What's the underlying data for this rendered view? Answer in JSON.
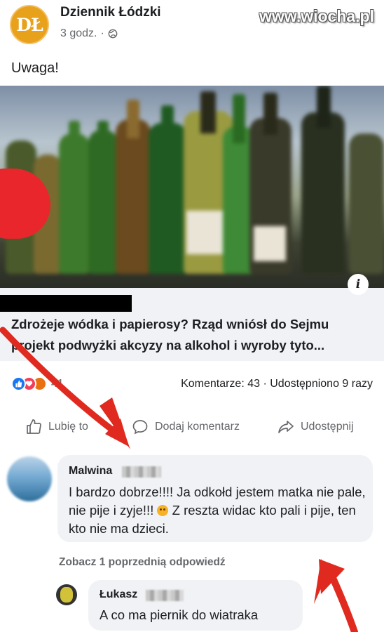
{
  "post": {
    "page_name": "Dziennik Łódzki",
    "logo_text": "DŁ",
    "time": "3 godz.",
    "dot": "·",
    "text": "Uwaga!"
  },
  "watermark": "www.wiocha.pl",
  "link": {
    "title": "Zdrożeje wódka i papierosy? Rząd wniósł do Sejmu projekt podwyżki akcyzy na alkohol i wyroby tyto...",
    "info_icon": "i"
  },
  "stats": {
    "reaction_count": "41",
    "comments_shares": "Komentarze: 43 · Udostępniono 9 razy"
  },
  "actions": {
    "like": "Lubię to",
    "comment": "Dodaj komentarz",
    "share": "Udostępnij"
  },
  "comments": [
    {
      "author": "Malwina",
      "text_before_emoji": "I bardzo dobrze!!!! Ja odkołd jestem matka nie pale, nie pije i zyje!!! ",
      "text_after_emoji": " Z reszta widac kto pali i pije, ten kto nie ma dzieci."
    }
  ],
  "previous_replies": "Zobacz 1 poprzednią odpowiedź",
  "reply": {
    "author": "Łukasz",
    "text": "A co ma piernik do wiatraka"
  },
  "colors": {
    "arrow": "#e02a1f",
    "fb_blue": "#1877f2",
    "bubble_bg": "#f0f2f5",
    "secondary_text": "#65676b"
  },
  "icons": [
    "globe-icon",
    "info-icon",
    "like-reaction-icon",
    "love-reaction-icon",
    "angry-reaction-icon",
    "thumbs-up-icon",
    "comment-icon",
    "share-icon",
    "angry-emoji-icon"
  ]
}
